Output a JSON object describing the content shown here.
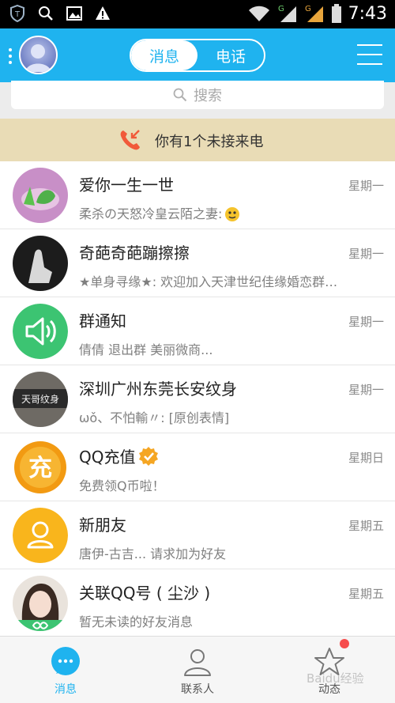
{
  "status_bar": {
    "time": "7:43",
    "network_labels": [
      "G",
      "G"
    ],
    "icons": [
      "shield-app-icon",
      "search-icon",
      "image-icon",
      "warning-icon",
      "wifi-icon",
      "signal-icon",
      "signal-icon",
      "battery-icon"
    ]
  },
  "header": {
    "tabs": [
      {
        "label": "消息",
        "active": true
      },
      {
        "label": "电话",
        "active": false
      }
    ]
  },
  "search": {
    "placeholder": "搜索"
  },
  "missed_call": {
    "text": "你有1个未接来电"
  },
  "conversations": [
    {
      "name": "爱你一生一世",
      "time": "星期一",
      "message": "柔杀の天怒冷皇云陌之妻:"
    },
    {
      "name": "奇葩奇葩蹦擦擦",
      "time": "星期一",
      "message": "★单身寻缘★: 欢迎加入天津世纪佳缘婚恋群…"
    },
    {
      "name": "群通知",
      "time": "星期一",
      "message": "倩倩 退出群 美丽微商..."
    },
    {
      "name": "深圳广州东莞长安纹身",
      "time": "星期一",
      "message": "ωǒ、不怕輸〃: [原创表情]",
      "avatar_text": "天哥纹身"
    },
    {
      "name": "QQ充值",
      "time": "星期日",
      "message": "免费领Q币啦！",
      "avatar_text": "充",
      "verified": true
    },
    {
      "name": "新朋友",
      "time": "星期五",
      "message": "唐伊-古吉... 请求加为好友"
    },
    {
      "name": "关联QQ号 ( 尘沙 )",
      "time": "星期五",
      "message": "暂无未读的好友消息"
    }
  ],
  "tabbar": {
    "tabs": [
      {
        "label": "消息",
        "active": true
      },
      {
        "label": "联系人",
        "active": false
      },
      {
        "label": "动态",
        "active": false
      }
    ]
  },
  "watermark": "Baidu经验",
  "colors": {
    "accent": "#1fb3ef",
    "banner": "#e9dcb6",
    "notification_dot": "#f64d4d",
    "group_notice": "#3cc472",
    "recharge": "#f29a12",
    "new_friend": "#f9b51c"
  }
}
